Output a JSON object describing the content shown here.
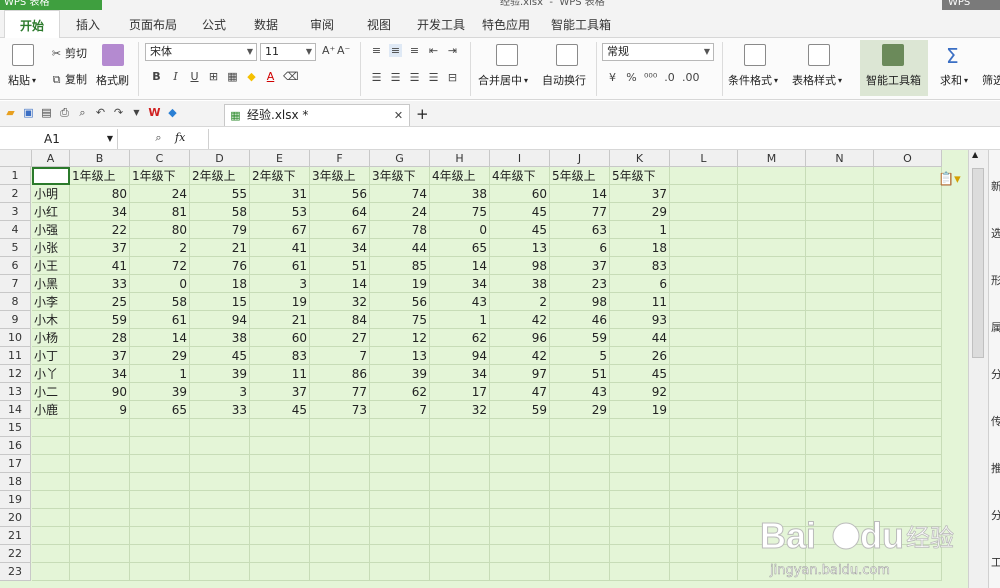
{
  "app": {
    "title": "WPS 表格",
    "file_title": "经验.xlsx  -  WPS 表格",
    "win": "WPS"
  },
  "tabs": [
    "开始",
    "插入",
    "页面布局",
    "公式",
    "数据",
    "审阅",
    "视图",
    "开发工具",
    "特色应用",
    "智能工具箱"
  ],
  "ribbon": {
    "paste": "粘贴",
    "cut": "剪切",
    "copy": "复制",
    "format_painter": "格式刷",
    "font": "宋体",
    "size": "11",
    "merge": "合并居中",
    "wrap": "自动换行",
    "numfmt": "常规",
    "cond": "条件格式",
    "table_style": "表格样式",
    "smart": "智能工具箱",
    "sum": "求和",
    "filter": "筛选"
  },
  "doc": {
    "tab": "经验.xlsx *"
  },
  "formula": {
    "cell": "A1",
    "fx": "fx"
  },
  "columns": [
    "A",
    "B",
    "C",
    "D",
    "E",
    "F",
    "G",
    "H",
    "I",
    "J",
    "K",
    "L",
    "M",
    "N",
    "O"
  ],
  "header_row": [
    "",
    "1年级上",
    "1年级下",
    "2年级上",
    "2年级下",
    "3年级上",
    "3年级下",
    "4年级上",
    "4年级下",
    "5年级上",
    "5年级下"
  ],
  "rows": [
    [
      "小明",
      80,
      24,
      55,
      31,
      56,
      74,
      38,
      60,
      14,
      37
    ],
    [
      "小红",
      34,
      81,
      58,
      53,
      64,
      24,
      75,
      45,
      77,
      29
    ],
    [
      "小强",
      22,
      80,
      79,
      67,
      67,
      78,
      0,
      45,
      63,
      1
    ],
    [
      "小张",
      37,
      2,
      21,
      41,
      34,
      44,
      65,
      13,
      6,
      18
    ],
    [
      "小王",
      41,
      72,
      76,
      61,
      51,
      85,
      14,
      98,
      37,
      83
    ],
    [
      "小黑",
      33,
      0,
      18,
      3,
      14,
      19,
      34,
      38,
      23,
      6
    ],
    [
      "小李",
      25,
      58,
      15,
      19,
      32,
      56,
      43,
      2,
      98,
      11
    ],
    [
      "小木",
      59,
      61,
      94,
      21,
      84,
      75,
      1,
      42,
      46,
      93
    ],
    [
      "小杨",
      28,
      14,
      38,
      60,
      27,
      12,
      62,
      96,
      59,
      44
    ],
    [
      "小丁",
      37,
      29,
      45,
      83,
      7,
      13,
      94,
      42,
      5,
      26
    ],
    [
      "小丫",
      34,
      1,
      39,
      11,
      86,
      39,
      34,
      97,
      51,
      45
    ],
    [
      "小二",
      90,
      39,
      3,
      37,
      77,
      62,
      17,
      47,
      43,
      92
    ],
    [
      "小鹿",
      9,
      65,
      33,
      45,
      73,
      7,
      32,
      59,
      29,
      19
    ]
  ],
  "row_count": 23,
  "sidebar": [
    "新",
    "选",
    "形",
    "属",
    "分",
    "传",
    "推",
    "分",
    "工"
  ],
  "watermark": {
    "brand": "Bai",
    "brand2": "du",
    "cn": "经验",
    "url": "jingyan.baidu.com"
  }
}
